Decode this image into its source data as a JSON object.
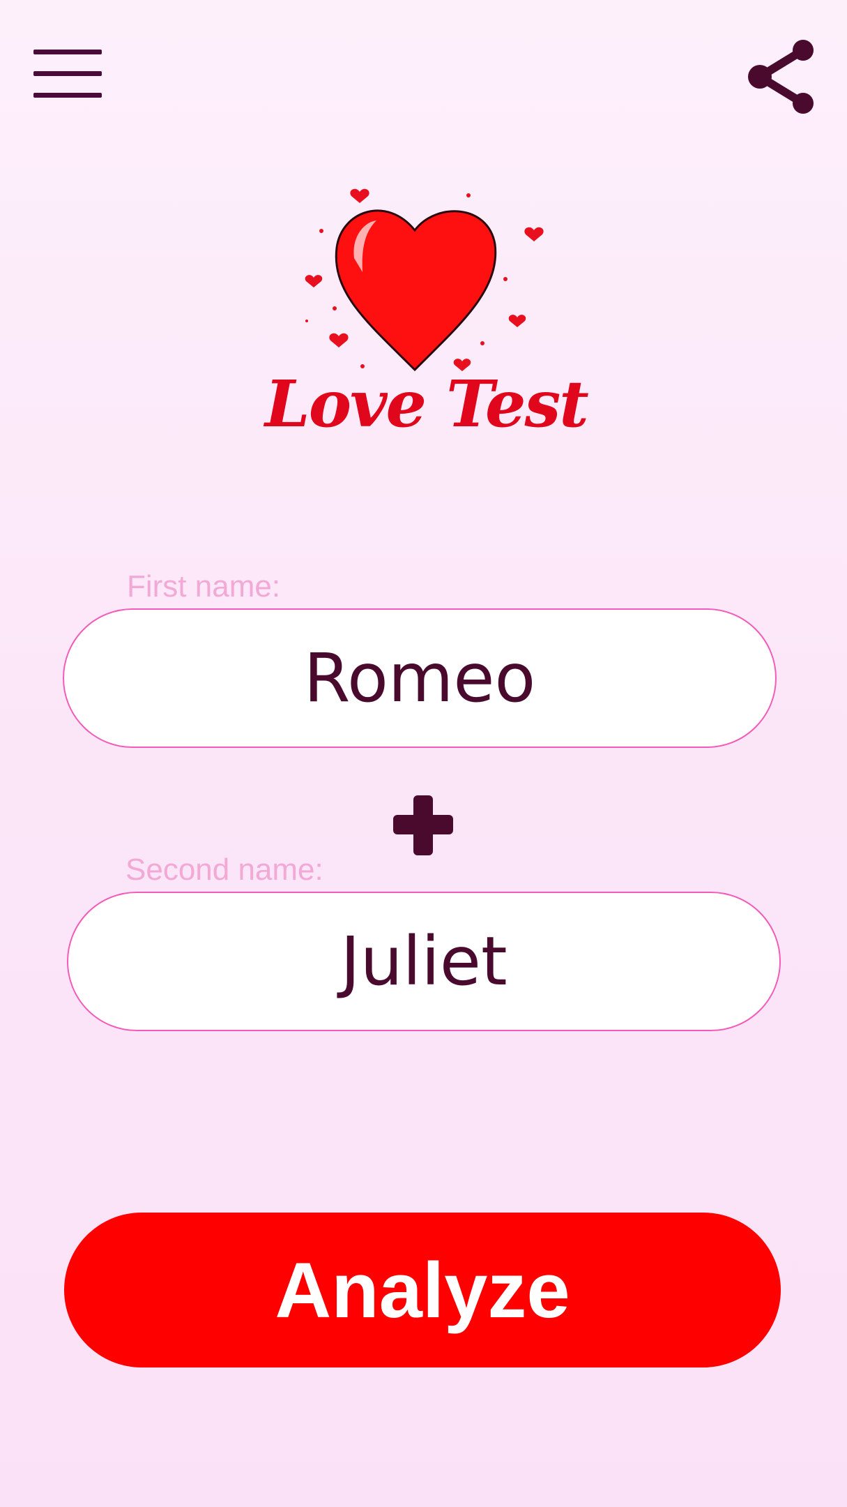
{
  "header": {
    "menu_icon": "hamburger-menu-icon",
    "share_icon": "share-icon"
  },
  "logo": {
    "title": "Love Test",
    "icon": "heart-icon"
  },
  "form": {
    "first_label": "First name:",
    "first_value": "Romeo",
    "plus_icon": "plus-icon",
    "second_label": "Second name:",
    "second_value": "Juliet"
  },
  "actions": {
    "analyze_label": "Analyze"
  },
  "colors": {
    "background_top": "#fdf0fb",
    "background_bottom": "#fbe1f7",
    "accent_red": "#ff0000",
    "heart_red": "#e0061b",
    "dark_purple": "#4a0a2e",
    "input_border": "#f25cb8",
    "label_pink": "#f2a9d6"
  }
}
